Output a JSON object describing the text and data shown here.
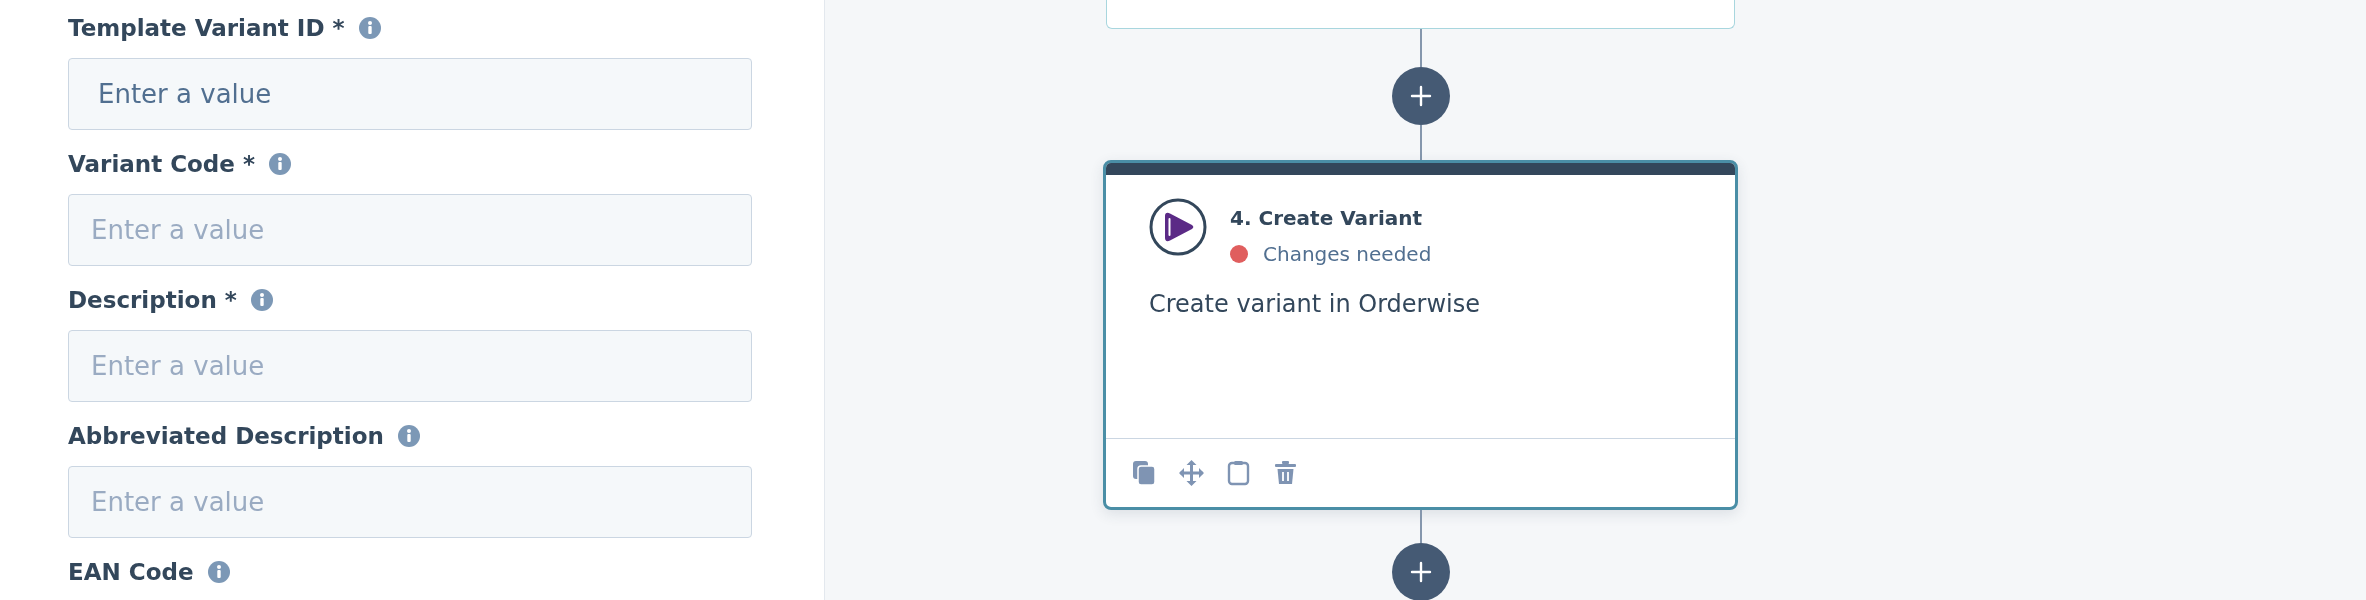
{
  "form": {
    "fields": [
      {
        "label": "Template Variant ID *",
        "placeholder": "Enter a value",
        "focused": true
      },
      {
        "label": "Variant Code *",
        "placeholder": "Enter a value",
        "focused": false
      },
      {
        "label": "Description *",
        "placeholder": "Enter a value",
        "focused": false
      },
      {
        "label": "Abbreviated Description",
        "placeholder": "Enter a value",
        "focused": false
      },
      {
        "label": "EAN Code"
      }
    ]
  },
  "canvas": {
    "step": {
      "title": "4. Create Variant",
      "status": {
        "text": "Changes needed",
        "color": "#e05e5e"
      },
      "description": "Create variant in Orderwise",
      "selected": true
    }
  }
}
